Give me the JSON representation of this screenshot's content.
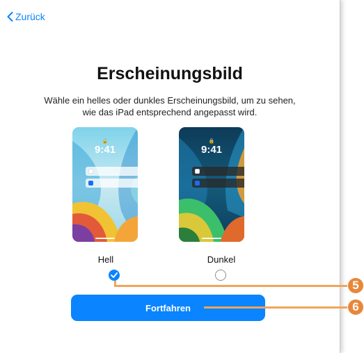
{
  "nav": {
    "back_label": "Zurück"
  },
  "page": {
    "title": "Erscheinungsbild",
    "subtitle": "Wähle ein helles oder dunkles Erscheinungsbild, um zu sehen, wie das iPad entsprechend angepasst wird."
  },
  "options": [
    {
      "label": "Hell",
      "time": "9:41",
      "selected": true
    },
    {
      "label": "Dunkel",
      "time": "9:41",
      "selected": false
    }
  ],
  "continue_label": "Fortfahren",
  "callouts": [
    "5",
    "6"
  ],
  "colors": {
    "accent": "#0a84ff",
    "callout": "#e8873a"
  }
}
